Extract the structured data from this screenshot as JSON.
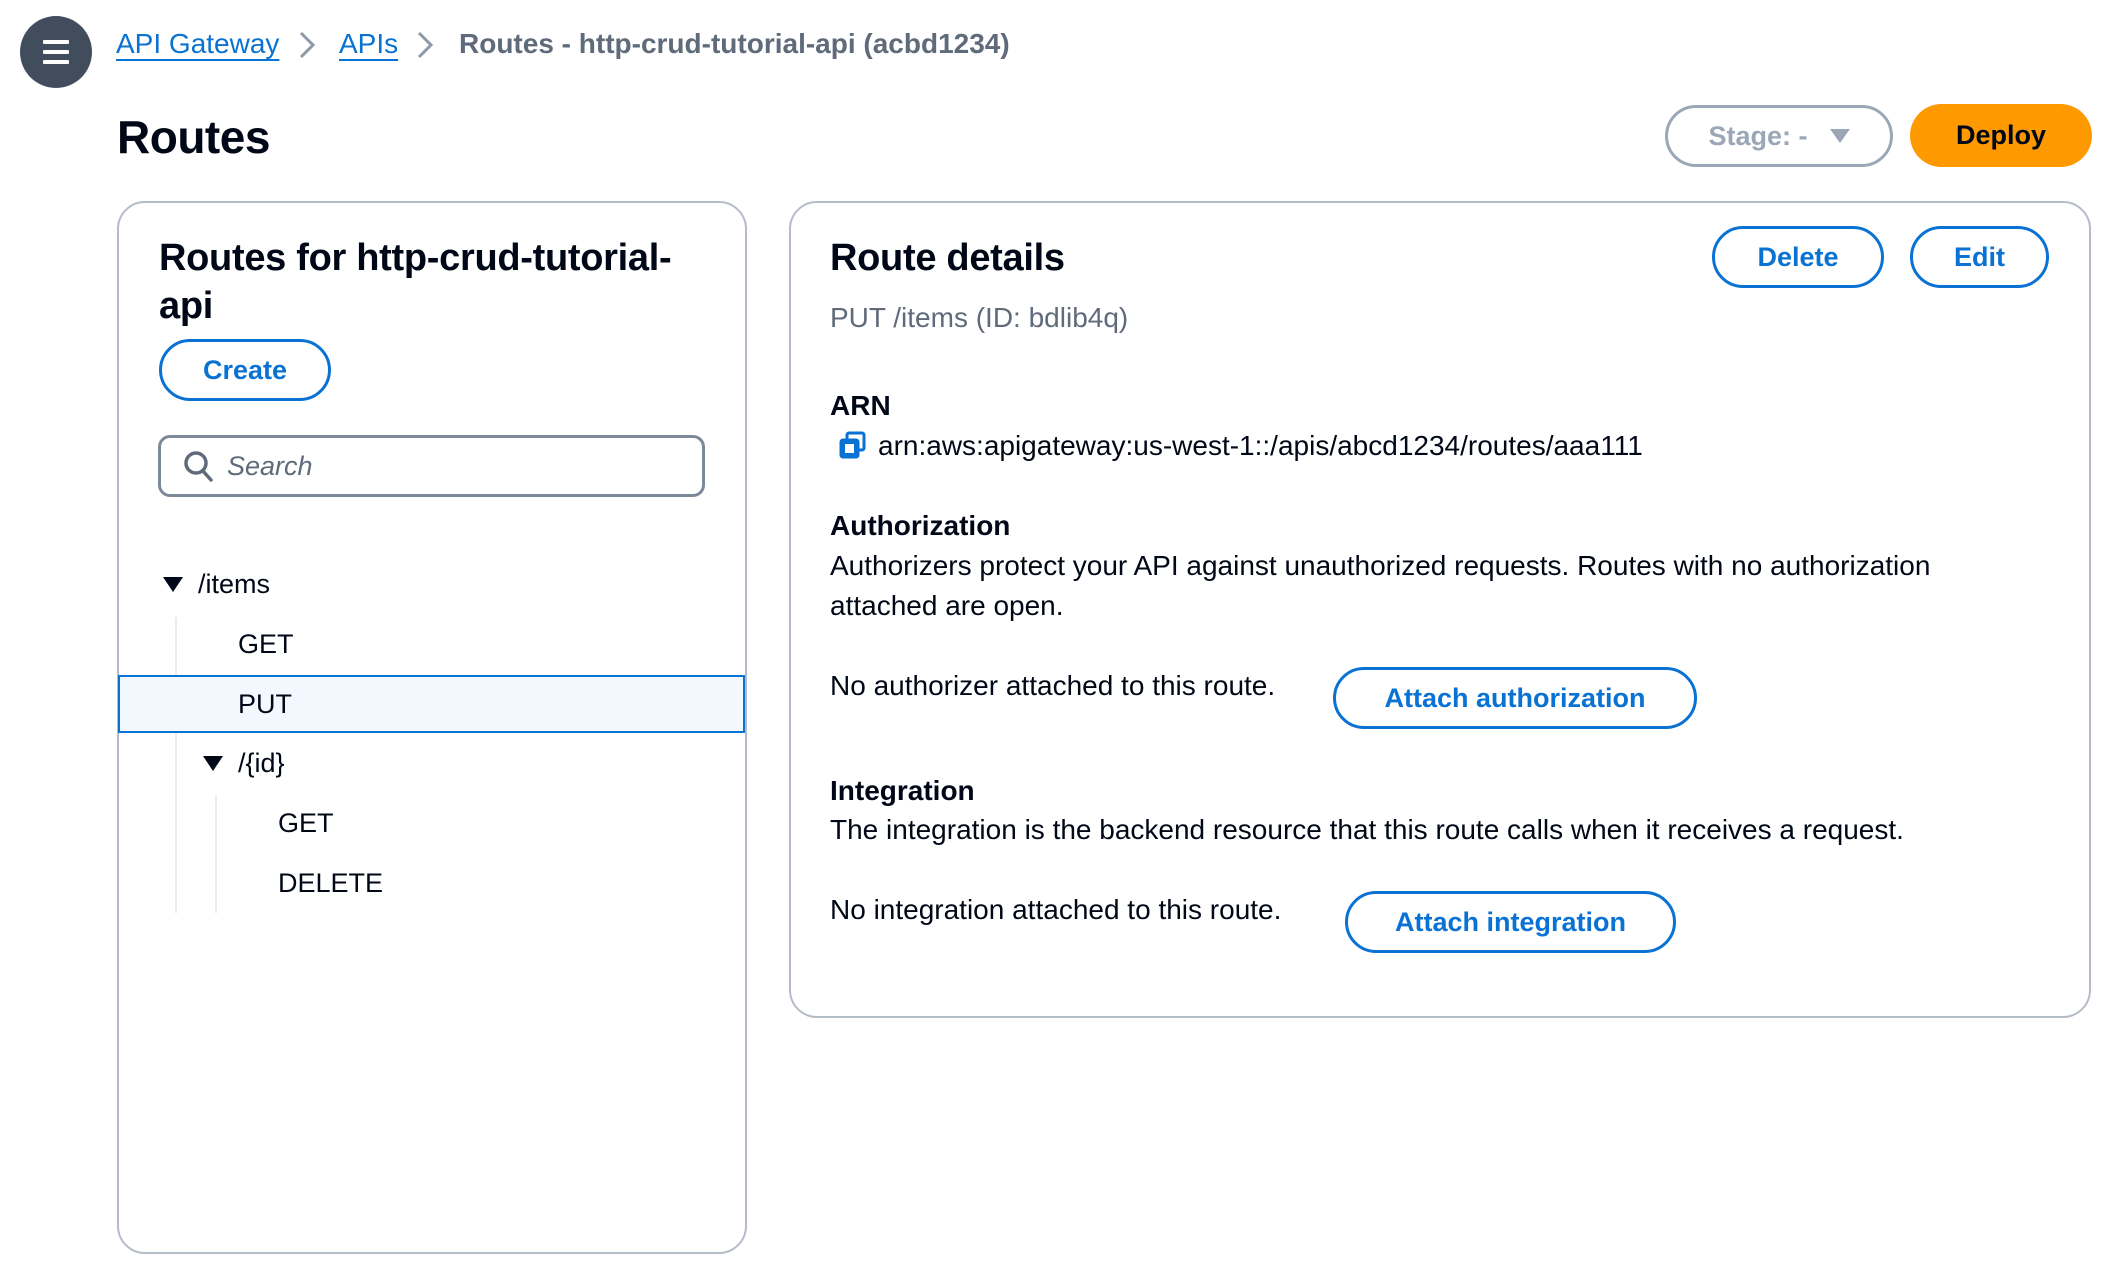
{
  "breadcrumb": {
    "items": [
      {
        "label": "API Gateway",
        "link": true
      },
      {
        "label": "APIs",
        "link": true
      },
      {
        "label": "Routes - http-crud-tutorial-api (acbd1234)",
        "link": false
      }
    ],
    "separator": "›"
  },
  "header": {
    "title": "Routes",
    "stage_label": "Stage: -",
    "deploy_label": "Deploy"
  },
  "routes_panel": {
    "title_line1": "Routes for http-crud-tutorial-",
    "title_line2": "api",
    "create_label": "Create",
    "search_placeholder": "Search",
    "search_value": "",
    "tree": {
      "items_path": "/items",
      "items_methods": [
        "GET",
        "PUT"
      ],
      "id_path": "/{id}",
      "id_methods": [
        "GET",
        "DELETE"
      ],
      "selected": "PUT /items"
    }
  },
  "details_panel": {
    "title": "Route details",
    "delete_label": "Delete",
    "edit_label": "Edit",
    "subtitle": "PUT /items (ID: bdlib4q)",
    "arn_label": "ARN",
    "arn_value": "arn:aws:apigateway:us-west-1::/apis/abcd1234/routes/aaa111",
    "authorization": {
      "heading": "Authorization",
      "desc_line1": "Authorizers protect your API against unauthorized requests. Routes with no authorization",
      "desc_line2": "attached are open.",
      "status": "No authorizer attached to this route.",
      "button": "Attach authorization"
    },
    "integration": {
      "heading": "Integration",
      "desc": "The integration is the backend resource that this route calls when it receives a request.",
      "status": "No integration attached to this route.",
      "button": "Attach integration"
    }
  },
  "colors": {
    "accent": "#0972d3",
    "primary_button": "#ff9900",
    "border": "#b4bcc8",
    "selected_row_bg": "#f2f8fd",
    "menu_bg": "#414d5c"
  }
}
